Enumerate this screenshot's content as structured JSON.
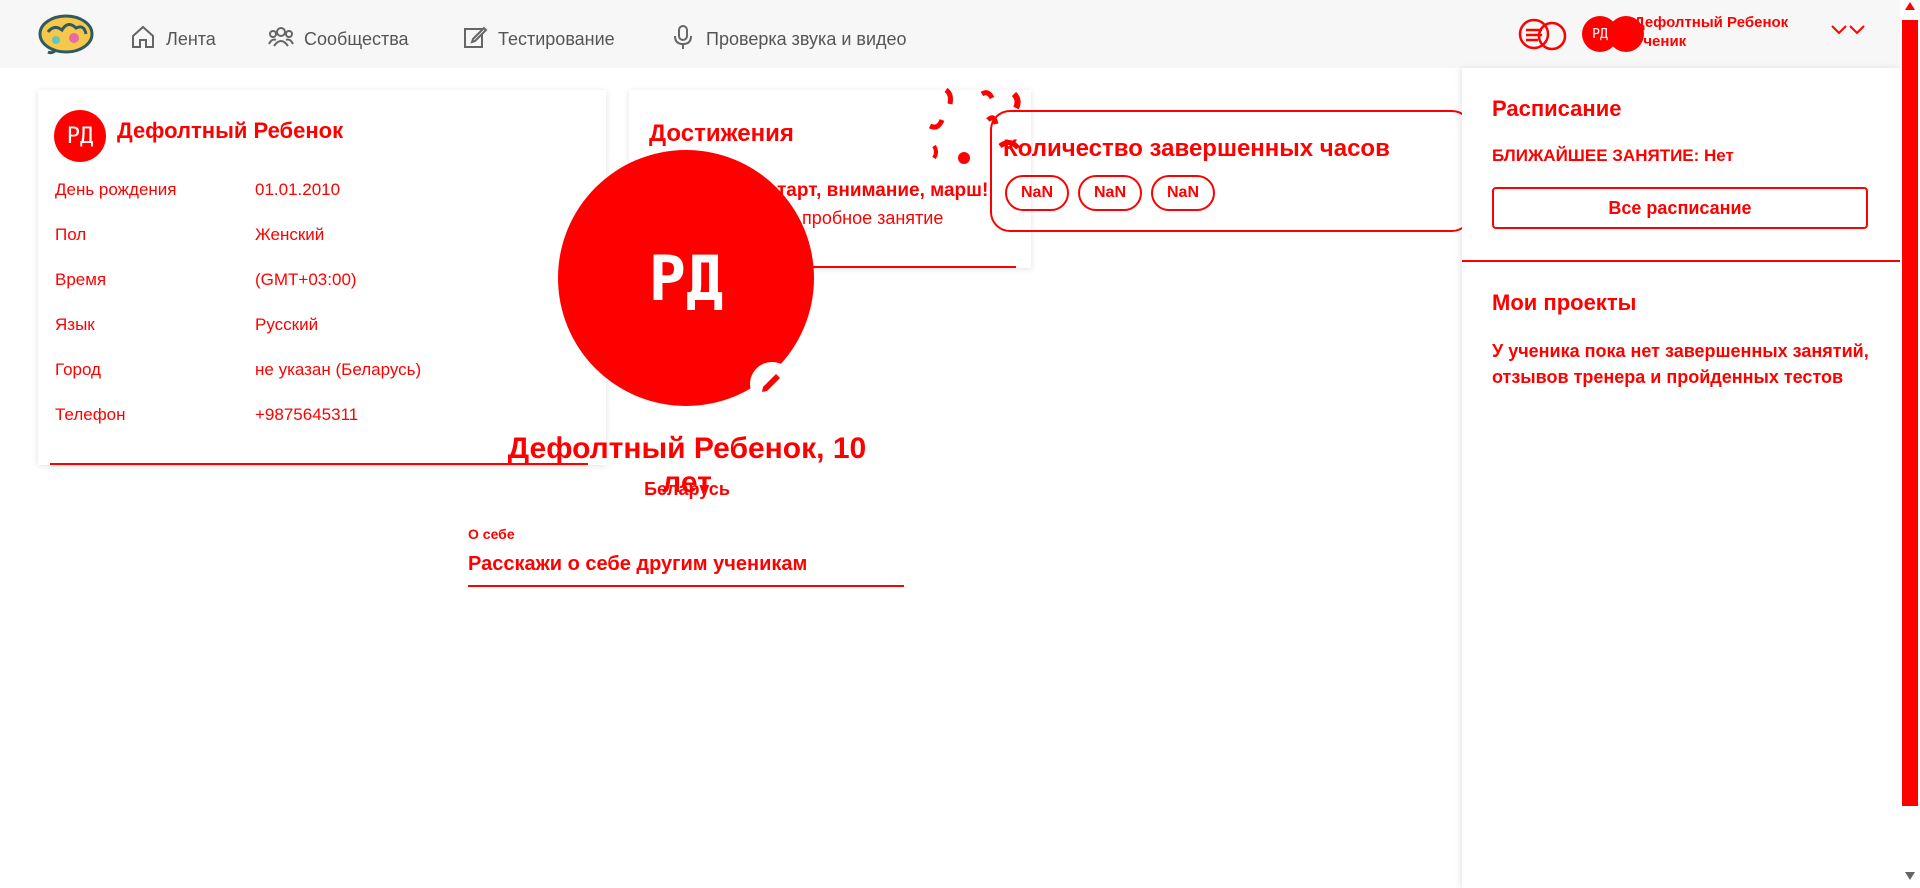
{
  "nav": {
    "items": [
      {
        "label": "Лента",
        "icon": "home-icon"
      },
      {
        "label": "Сообщества",
        "icon": "users-icon"
      },
      {
        "label": "Тестирование",
        "icon": "edit-icon"
      },
      {
        "label": "Проверка звука и видео",
        "icon": "microphone-icon"
      }
    ]
  },
  "header": {
    "avatar_initials": "РД",
    "user_name": "Дефолтный Ребенок",
    "user_role": "Ученик"
  },
  "profile": {
    "initials": "РД",
    "name": "Дефолтный Ребенок",
    "rows": [
      {
        "label": "День рождения",
        "value": "01.01.2010"
      },
      {
        "label": "Пол",
        "value": "Женский"
      },
      {
        "label": "Время",
        "value": "(GMT+03:00)"
      },
      {
        "label": "Язык",
        "value": "Русский"
      },
      {
        "label": "Город",
        "value": "не указан (Беларусь)"
      },
      {
        "label": "Телефон",
        "value": "+9875645311"
      }
    ]
  },
  "achievements": {
    "title": "Достижения",
    "line1": "тарт, внимание, марш!",
    "line2": "и пробное занятие"
  },
  "hours": {
    "title": "Количество завершенных часов",
    "values": [
      "NaN",
      "NaN",
      "NaN"
    ]
  },
  "center_profile": {
    "initials": "РД",
    "name_age": "Дефолтный Ребенок, 10 лет",
    "country": "Беларусь",
    "about_label": "О себе",
    "about_placeholder": "Расскажи о себе другим ученикам"
  },
  "schedule": {
    "title": "Расписание",
    "next_lesson": "БЛИЖАЙШЕЕ ЗАНЯТИЕ: Нет",
    "all_button": "Все расписание"
  },
  "projects": {
    "title": "Мои проекты",
    "empty_text": "У ученика пока нет завершенных занятий, отзывов тренера и пройденных тестов"
  },
  "colors": {
    "accent": "#ff0000",
    "topbar_bg": "#f7f7f7",
    "nav_text": "#555555"
  }
}
